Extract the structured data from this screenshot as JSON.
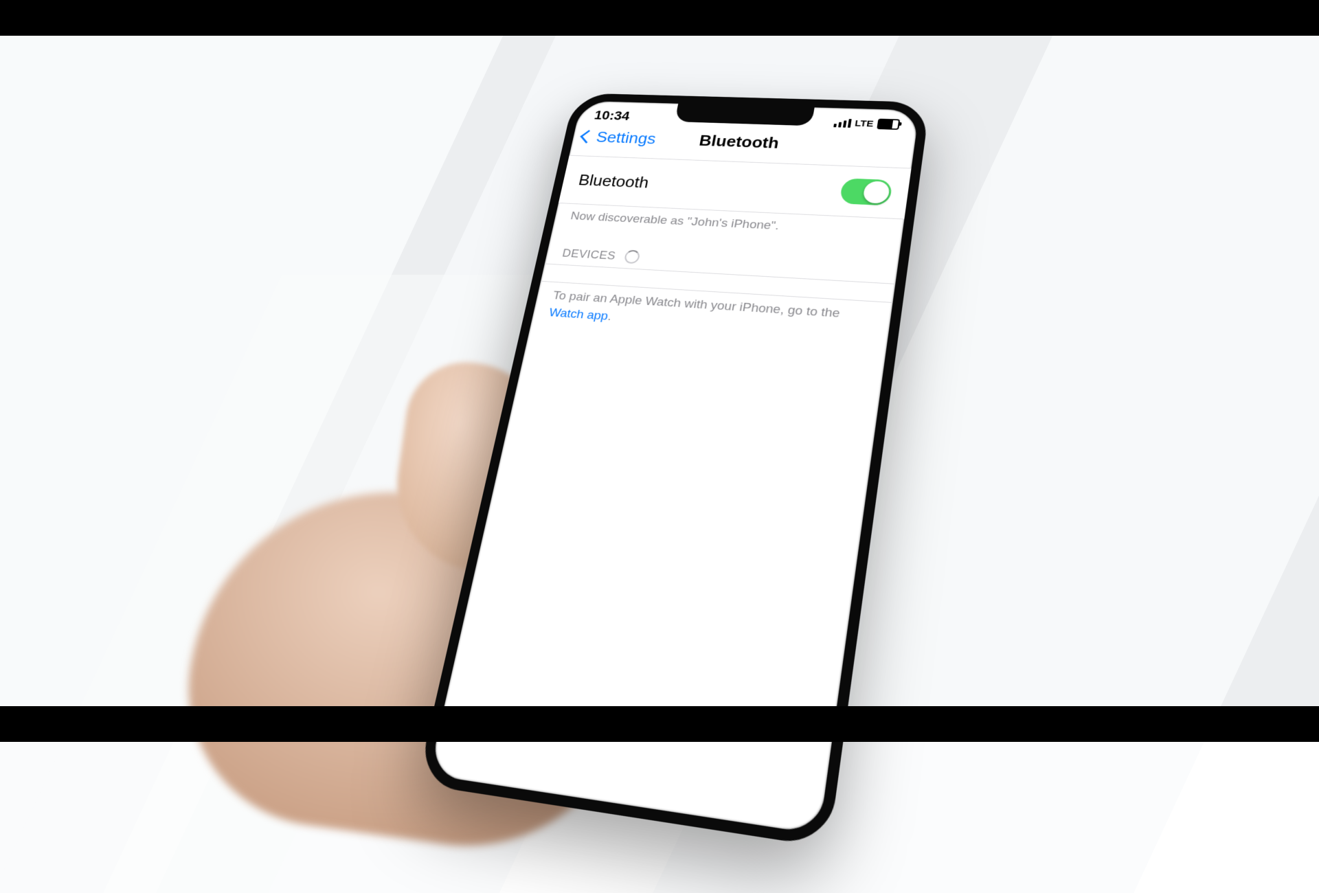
{
  "status": {
    "time": "10:34",
    "net": "LTE"
  },
  "nav": {
    "back": "Settings",
    "title": "Bluetooth"
  },
  "row": {
    "label": "Bluetooth",
    "on": true
  },
  "discover": "Now discoverable as \"John's iPhone\".",
  "section": "DEVICES",
  "hint_pre": "To pair an Apple Watch with your iPhone, go to the ",
  "hint_link": "Watch app",
  "hint_post": "."
}
